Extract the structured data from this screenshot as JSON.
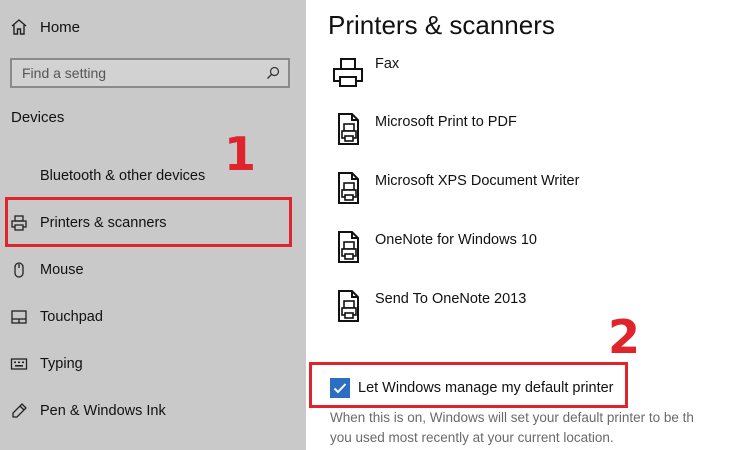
{
  "sidebar": {
    "home_label": "Home",
    "search_placeholder": "Find a setting",
    "section_title": "Devices",
    "items": [
      {
        "label": "Bluetooth & other devices",
        "icon": "bluetooth-icon"
      },
      {
        "label": "Printers & scanners",
        "icon": "printer-icon"
      },
      {
        "label": "Mouse",
        "icon": "mouse-icon"
      },
      {
        "label": "Touchpad",
        "icon": "touchpad-icon"
      },
      {
        "label": "Typing",
        "icon": "keyboard-icon"
      },
      {
        "label": "Pen & Windows Ink",
        "icon": "pen-icon"
      }
    ]
  },
  "main": {
    "title": "Printers & scanners",
    "printers": [
      {
        "label": "Fax",
        "icon": "fax-icon"
      },
      {
        "label": "Microsoft Print to PDF",
        "icon": "printer-document-icon"
      },
      {
        "label": "Microsoft XPS Document Writer",
        "icon": "printer-document-icon"
      },
      {
        "label": "OneNote for Windows 10",
        "icon": "printer-document-icon"
      },
      {
        "label": "Send To OneNote 2013",
        "icon": "printer-document-icon"
      }
    ],
    "default_printer": {
      "label": "Let Windows manage my default printer",
      "checked": true,
      "help_line1": "When this is on, Windows will set your default printer to be th",
      "help_line2": "you used most recently at your current location."
    }
  },
  "annotations": {
    "step1": "1",
    "step2": "2"
  },
  "colors": {
    "sidebar_bg": "#c9c9c9",
    "accent": "#2a6fc1",
    "annotation_red": "#e0242b"
  }
}
